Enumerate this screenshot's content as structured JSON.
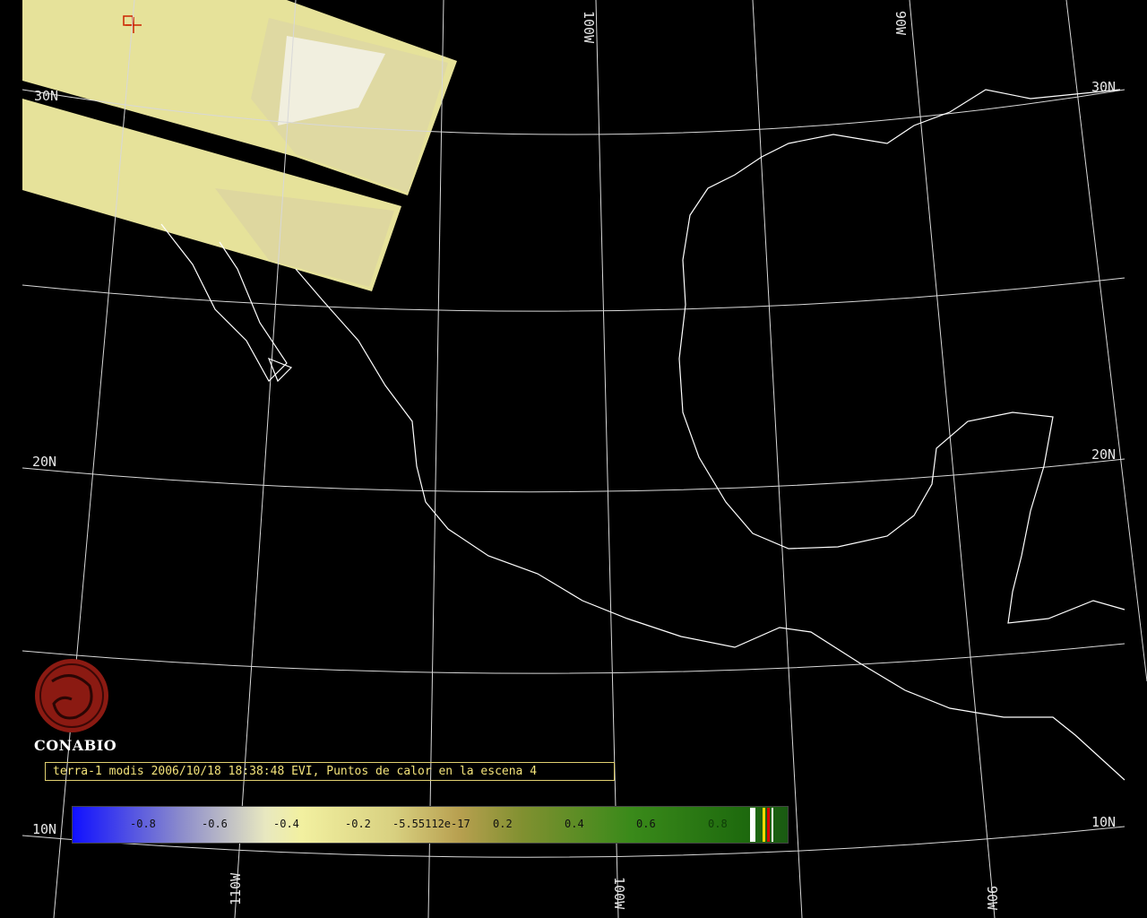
{
  "grid_labels": {
    "lat_30_left": "30N",
    "lat_30_right": "30N",
    "lat_20_left": "20N",
    "lat_20_right": "20N",
    "lat_10_left": "10N",
    "lat_10_right": "10N",
    "lon_100_top": "100W",
    "lon_90_top": "90W",
    "lon_110_bottom": "110W",
    "lon_100_bottom": "100W",
    "lon_90_bottom": "90W"
  },
  "logo": {
    "text": "CONABIO"
  },
  "caption": "terra-1 modis 2006/10/18 18:38:48 EVI, Puntos de calor en la escena 4",
  "colorbar": {
    "ticks": [
      "-0.8",
      "-0.6",
      "-0.4",
      "-0.2",
      "-5.55112e-17",
      "0.2",
      "0.4",
      "0.6",
      "0.8"
    ]
  },
  "colors": {
    "background": "#000000",
    "grid": "#d8d8d8",
    "coast": "#ffffff",
    "caption_text": "#f4e37a",
    "logo": "#8b1a12",
    "imagery": "#e8e49a"
  }
}
